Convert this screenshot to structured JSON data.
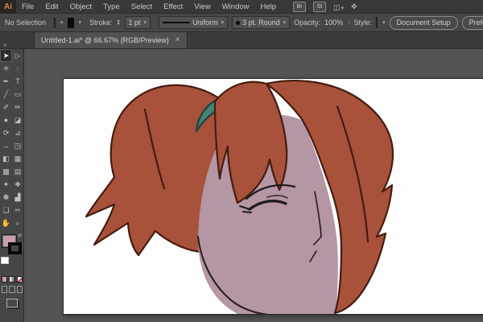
{
  "menubar": {
    "logo": "Ai",
    "items": [
      "File",
      "Edit",
      "Object",
      "Type",
      "Select",
      "Effect",
      "View",
      "Window",
      "Help"
    ],
    "right_buttons": [
      {
        "name": "bridge-button",
        "label": "Br"
      },
      {
        "name": "stock-button",
        "label": "St"
      }
    ]
  },
  "icons": {
    "chevron_down": "▾",
    "stepper_up": "▲",
    "stepper_down": "▼",
    "arrange_documents": "◫",
    "touch_workspace": "✥",
    "workspace_switcher": "◫",
    "panel_collapse": "»",
    "opacity_more": "›",
    "swap_arrows": "⇄"
  },
  "controlbar": {
    "selection_status": "No Selection",
    "stroke_label": "Stroke:",
    "stroke_weight": "1 pt",
    "width_profile": "Uniform",
    "brush_definition": "3 pt. Round",
    "opacity_label": "Opacity:",
    "opacity_value": "100%",
    "style_label": "Style:",
    "document_setup_label": "Document Setup",
    "preferences_label": "Preferences"
  },
  "document_tab": {
    "title": "Untitled-1.ai* @ 66.67% (RGB/Preview)",
    "close_glyph": "×"
  },
  "toolbar": {
    "tools": [
      {
        "name": "selection-tool",
        "glyph": "➤",
        "active": true
      },
      {
        "name": "direct-selection-tool",
        "glyph": "▷",
        "active": false
      },
      {
        "name": "magic-wand-tool",
        "glyph": "✳",
        "active": false
      },
      {
        "name": "lasso-tool",
        "glyph": "◌",
        "active": false
      },
      {
        "name": "pen-tool",
        "glyph": "✒",
        "active": false
      },
      {
        "name": "type-tool",
        "glyph": "T",
        "active": false
      },
      {
        "name": "line-segment-tool",
        "glyph": "╱",
        "active": false
      },
      {
        "name": "rectangle-tool",
        "glyph": "▭",
        "active": false
      },
      {
        "name": "paintbrush-tool",
        "glyph": "✐",
        "active": false
      },
      {
        "name": "pencil-tool",
        "glyph": "✏",
        "active": false
      },
      {
        "name": "blob-brush-tool",
        "glyph": "●",
        "active": false
      },
      {
        "name": "eraser-tool",
        "glyph": "◪",
        "active": false
      },
      {
        "name": "rotate-tool",
        "glyph": "⟳",
        "active": false
      },
      {
        "name": "scale-tool",
        "glyph": "⊿",
        "active": false
      },
      {
        "name": "width-tool",
        "glyph": "↔",
        "active": false
      },
      {
        "name": "free-transform-tool",
        "glyph": "◳",
        "active": false
      },
      {
        "name": "shape-builder-tool",
        "glyph": "◧",
        "active": false
      },
      {
        "name": "perspective-grid-tool",
        "glyph": "▦",
        "active": false
      },
      {
        "name": "mesh-tool",
        "glyph": "▩",
        "active": false
      },
      {
        "name": "gradient-tool",
        "glyph": "▤",
        "active": false
      },
      {
        "name": "eyedropper-tool",
        "glyph": "✦",
        "active": false
      },
      {
        "name": "blend-tool",
        "glyph": "❖",
        "active": false
      },
      {
        "name": "symbol-sprayer-tool",
        "glyph": "✽",
        "active": false
      },
      {
        "name": "column-graph-tool",
        "glyph": "▟",
        "active": false
      },
      {
        "name": "artboard-tool",
        "glyph": "❏",
        "active": false
      },
      {
        "name": "slice-tool",
        "glyph": "✂",
        "active": false
      },
      {
        "name": "hand-tool",
        "glyph": "✋",
        "active": false
      },
      {
        "name": "zoom-tool",
        "glyph": "⌕",
        "active": false
      }
    ]
  },
  "colors": {
    "fill_swatch": "#c79fae",
    "stroke_swatch": "#000000",
    "artboard": "#fdfdfd",
    "hair": "#a8523b",
    "hair_outline": "#451c0f",
    "hair_tie": "#418374",
    "tie_outline": "#1c443b",
    "skin": "#b496a4",
    "line_art": "#221a1c"
  }
}
